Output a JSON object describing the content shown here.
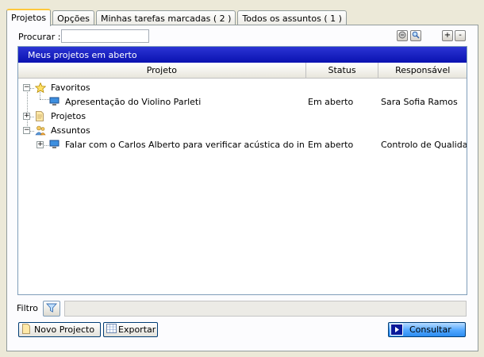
{
  "tabs": [
    {
      "label": "Projetos"
    },
    {
      "label": "Opções"
    },
    {
      "label": "Minhas tarefas marcadas ( 2 )"
    },
    {
      "label": "Todos os assuntos ( 1 )"
    }
  ],
  "search": {
    "label": "Procurar :",
    "value": ""
  },
  "toolbar": {
    "add_label": "+",
    "remove_label": "-"
  },
  "grid": {
    "title": "Meus projetos em aberto",
    "columns": [
      "Projeto",
      "Status",
      "Responsável"
    ],
    "rows": [
      {
        "name": "Favoritos",
        "status": "",
        "owner": ""
      },
      {
        "name": "Apresentação do Violino Parleti",
        "status": "Em aberto",
        "owner": "Sara Sofia Ramos"
      },
      {
        "name": "Projetos",
        "status": "",
        "owner": ""
      },
      {
        "name": "Assuntos",
        "status": "",
        "owner": ""
      },
      {
        "name": "Falar com o Carlos Alberto para verificar acústica do instrum…",
        "status": "Em aberto",
        "owner": "Controlo de Qualidade"
      }
    ],
    "expanders": {
      "minus": "−",
      "plus": "+"
    }
  },
  "filter": {
    "label": "Filtro",
    "value": ""
  },
  "buttons": {
    "new_project": "Novo Projecto",
    "export": "Exportar",
    "consult": "Consultar"
  },
  "colors": {
    "grid_title_bg": "#1b23c4",
    "tab_highlight": "#ffc83c",
    "consult_bg": "#51a7ff"
  }
}
